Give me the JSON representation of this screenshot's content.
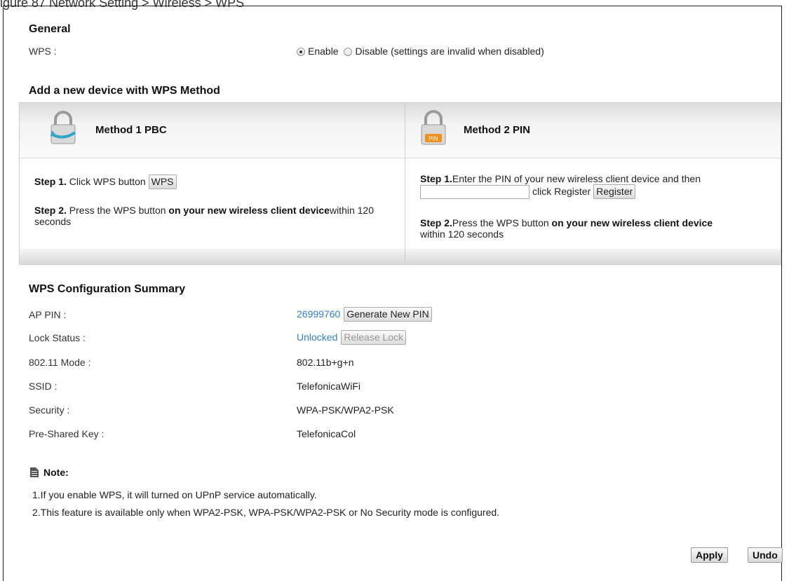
{
  "caption": "igure 87 Network Setting > Wireless > WPS",
  "general": {
    "title": "General",
    "wps_label": "WPS :",
    "enable_label": "Enable",
    "disable_label": "Disable (settings are invalid when disabled)",
    "selected": "Enable"
  },
  "add_device": {
    "title": "Add a new device with WPS Method",
    "method1": {
      "title": "Method 1 PBC",
      "step1_prefix": "Step 1.",
      "step1_text": " Click WPS button ",
      "wps_button": "WPS",
      "step2_prefix": "Step 2.",
      "step2_text1": " Press the WPS button ",
      "step2_bold": "on your new wireless client device",
      "step2_text2": "within 120 seconds"
    },
    "method2": {
      "title": "Method 2 PIN",
      "pin_icon_text": "PIN",
      "step1_prefix": "Step 1.",
      "step1_text": "Enter the PIN of your new wireless client device and then",
      "pin_value": "",
      "click_register": "click Register ",
      "register_button": "Register",
      "step2_prefix": "Step 2.",
      "step2_text1": "Press the WPS button ",
      "step2_bold": "on your new wireless client device",
      "step2_text2": "within 120 seconds"
    }
  },
  "summary": {
    "title": "WPS Configuration Summary",
    "ap_pin_label": "AP PIN :",
    "ap_pin_value": "26999760",
    "generate_button": "Generate New PIN",
    "lock_status_label": "Lock Status :",
    "lock_status_value": "Unlocked",
    "release_lock_button": "Release Lock",
    "mode_label": "802.11 Mode :",
    "mode_value": "802.11b+g+n",
    "ssid_label": "SSID :",
    "ssid_value": "TelefonicaWiFi",
    "security_label": "Security :",
    "security_value": "WPA-PSK/WPA2-PSK",
    "psk_label": "Pre-Shared Key :",
    "psk_value": "TelefonicaCol"
  },
  "note": {
    "title": "Note:",
    "lines": [
      "1.If you enable WPS, it will turned on UPnP service automatically.",
      "2.This feature is available only when WPA2-PSK, WPA-PSK/WPA2-PSK or No Security mode is configured."
    ]
  },
  "buttons": {
    "apply": "Apply",
    "undo": "Undo"
  },
  "colors": {
    "link": "#2f7fd6",
    "pin_badge": "#f0901e"
  }
}
